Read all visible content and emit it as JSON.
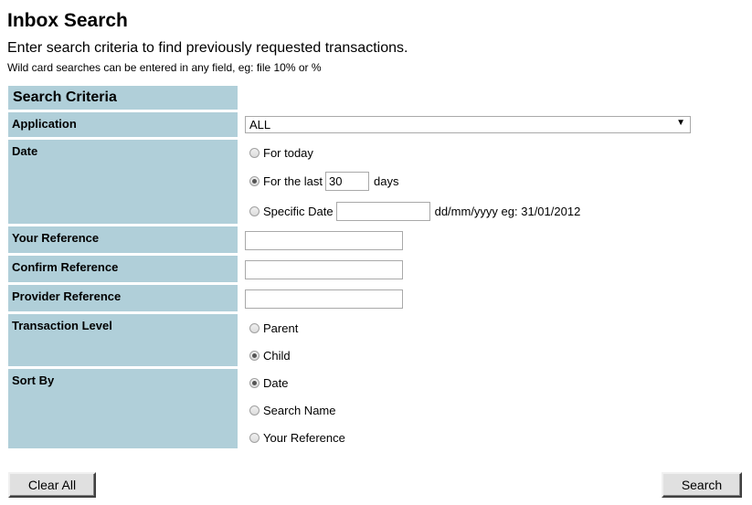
{
  "title": "Inbox Search",
  "intro": "Enter search criteria to find previously requested transactions.",
  "note": "Wild card searches can be entered in any field, eg: file 10% or %",
  "criteria_header": "Search Criteria",
  "labels": {
    "application": "Application",
    "date": "Date",
    "your_ref": "Your Reference",
    "confirm_ref": "Confirm Reference",
    "provider_ref": "Provider Reference",
    "level": "Transaction Level",
    "sort": "Sort By"
  },
  "application": {
    "value": "ALL"
  },
  "date": {
    "today": "For today",
    "last": "For the last",
    "days_value": "30",
    "days": "days",
    "specific": "Specific Date",
    "specific_value": "",
    "format_hint": "dd/mm/yyyy eg: 31/01/2012",
    "selected": "last"
  },
  "your_ref": "",
  "confirm_ref": "",
  "provider_ref": "",
  "level": {
    "parent": "Parent",
    "child": "Child",
    "selected": "child"
  },
  "sort": {
    "date": "Date",
    "search_name": "Search Name",
    "your_ref": "Your Reference",
    "selected": "date"
  },
  "buttons": {
    "clear": "Clear All",
    "search": "Search"
  }
}
